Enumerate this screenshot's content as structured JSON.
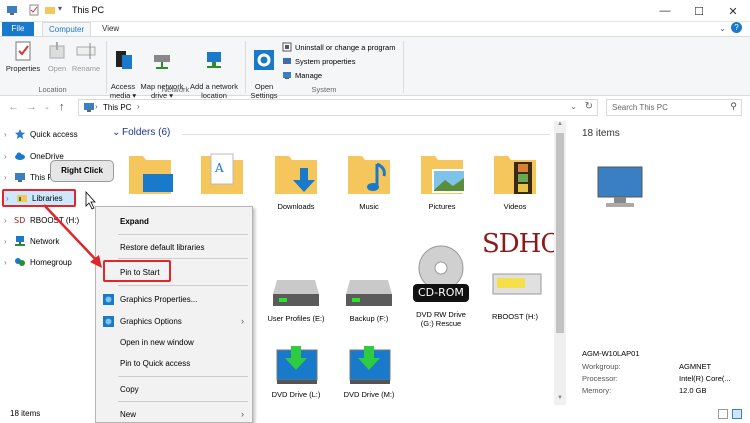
{
  "window": {
    "title": "This PC",
    "minimize_glyph": "—",
    "maximize_glyph": "☐",
    "close_glyph": "✕"
  },
  "ribbon_tabs": [
    {
      "label": "File"
    },
    {
      "label": "Computer"
    },
    {
      "label": "View"
    }
  ],
  "ribbon": {
    "location": {
      "label": "Location",
      "buttons": [
        {
          "label": "Properties",
          "icon": "properties-icon",
          "enabled": true
        },
        {
          "label": "Open",
          "icon": "open-icon",
          "enabled": false
        },
        {
          "label": "Rename",
          "icon": "rename-icon",
          "enabled": false
        }
      ]
    },
    "network": {
      "label": "Network",
      "buttons": [
        {
          "label": "Access\nmedia ▾",
          "icon": "access-media-icon"
        },
        {
          "label": "Map network\ndrive ▾",
          "icon": "map-network-drive-icon"
        },
        {
          "label": "Add a network\nlocation",
          "icon": "add-network-location-icon"
        }
      ]
    },
    "system": {
      "label": "System",
      "open_settings": "Open\nSettings",
      "items": [
        {
          "label": "Uninstall or change a program"
        },
        {
          "label": "System properties"
        },
        {
          "label": "Manage"
        }
      ]
    }
  },
  "address": {
    "crumb": "This PC",
    "sep": "›",
    "search_placeholder": "Search This PC"
  },
  "nav_pane": [
    {
      "label": "Quick access",
      "icon": "star-icon"
    },
    {
      "label": "OneDrive",
      "icon": "cloud-icon"
    },
    {
      "label": "This PC",
      "icon": "computer-icon"
    },
    {
      "label": "Libraries",
      "icon": "library-icon"
    },
    {
      "label": "RBOOST (H:)",
      "icon": "sd-card-icon"
    },
    {
      "label": "Network",
      "icon": "network-icon"
    },
    {
      "label": "Homegroup",
      "icon": "homegroup-icon"
    }
  ],
  "folders_header": "Folders (6)",
  "folders": [
    {
      "label": "",
      "icon": "desktop-folder-icon"
    },
    {
      "label": "",
      "icon": "documents-folder-icon"
    },
    {
      "label": "Downloads",
      "icon": "downloads-folder-icon"
    },
    {
      "label": "Music",
      "icon": "music-folder-icon"
    },
    {
      "label": "Pictures",
      "icon": "pictures-folder-icon"
    },
    {
      "label": "Videos",
      "icon": "videos-folder-icon"
    }
  ],
  "drives_row1": [
    {
      "label": "User Profiles (E:)",
      "icon": "hard-drive-icon"
    },
    {
      "label": "Backup (F:)",
      "icon": "hard-drive-icon"
    },
    {
      "label": "DVD RW Drive\n(G:) Rescue",
      "icon": "cd-rom-icon",
      "badge": "CD-ROM"
    },
    {
      "label": "RBOOST (H:)",
      "icon": "sdhc-icon",
      "badge": "SDHC"
    }
  ],
  "drives_row2": [
    {
      "label": "DVD Drive (L:)",
      "icon": "dvd-drive-icon"
    },
    {
      "label": "DVD Drive (M:)",
      "icon": "dvd-drive-icon"
    }
  ],
  "details": {
    "count": "18 items",
    "computer_name": "AGM-W10LAP01",
    "props": [
      {
        "k": "Workgroup:",
        "v": "AGMNET"
      },
      {
        "k": "Processor:",
        "v": "Intel(R) Core(..."
      },
      {
        "k": "Memory:",
        "v": "12.0 GB"
      }
    ]
  },
  "status": {
    "items": "18 items"
  },
  "callout": "Right Click",
  "context_menu": [
    {
      "label": "Expand",
      "bold": true
    },
    {
      "label": "Restore default libraries"
    },
    {
      "label": "Pin to Start"
    },
    {
      "label": "Graphics Properties...",
      "icon": "graphics-icon"
    },
    {
      "label": "Graphics Options",
      "icon": "graphics-icon",
      "submenu": "›"
    },
    {
      "label": "Open in new window"
    },
    {
      "label": "Pin to Quick access"
    },
    {
      "label": "Copy"
    },
    {
      "label": "New",
      "submenu": "›"
    }
  ],
  "colors": {
    "accent": "#1979ca",
    "highlight_red": "#e0262a",
    "folder_yellow": "#f4c65c"
  }
}
